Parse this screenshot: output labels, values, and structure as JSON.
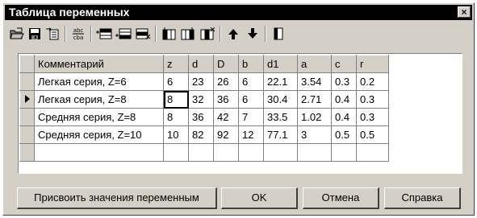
{
  "window": {
    "title": "Таблица переменных",
    "close_label": "×"
  },
  "toolbar": {
    "icons": [
      "open-folder-icon",
      "save-icon",
      "import-icon",
      "sort-text-icon",
      "insert-row-above-icon",
      "insert-row-below-icon",
      "delete-row-icon",
      "insert-column-left-icon",
      "insert-column-right-icon",
      "delete-column-icon",
      "move-up-icon",
      "move-down-icon",
      "panel-icon"
    ],
    "sort_text_top": "abc",
    "sort_text_bottom": "cba"
  },
  "table": {
    "columns": [
      "Комментарий",
      "z",
      "d",
      "D",
      "b",
      "d1",
      "a",
      "c",
      "r"
    ],
    "rows": [
      [
        "Легкая серия, Z=6",
        "6",
        "23",
        "26",
        "6",
        "22.1",
        "3.54",
        "0.3",
        "0.2"
      ],
      [
        "Легкая серия, Z=8",
        "8",
        "32",
        "36",
        "6",
        "30.4",
        "2.71",
        "0.4",
        "0.3"
      ],
      [
        "Средняя серия, Z=8",
        "8",
        "36",
        "42",
        "7",
        "33.5",
        "1.02",
        "0.4",
        "0.3"
      ],
      [
        "Средняя серия, Z=10",
        "10",
        "82",
        "92",
        "12",
        "77.1",
        "3",
        "0.5",
        "0.5"
      ]
    ],
    "current_row": 1
  },
  "buttons": {
    "assign": "Присвоить значения переменным",
    "ok": "OK",
    "cancel": "Отмена",
    "help": "Справка"
  }
}
